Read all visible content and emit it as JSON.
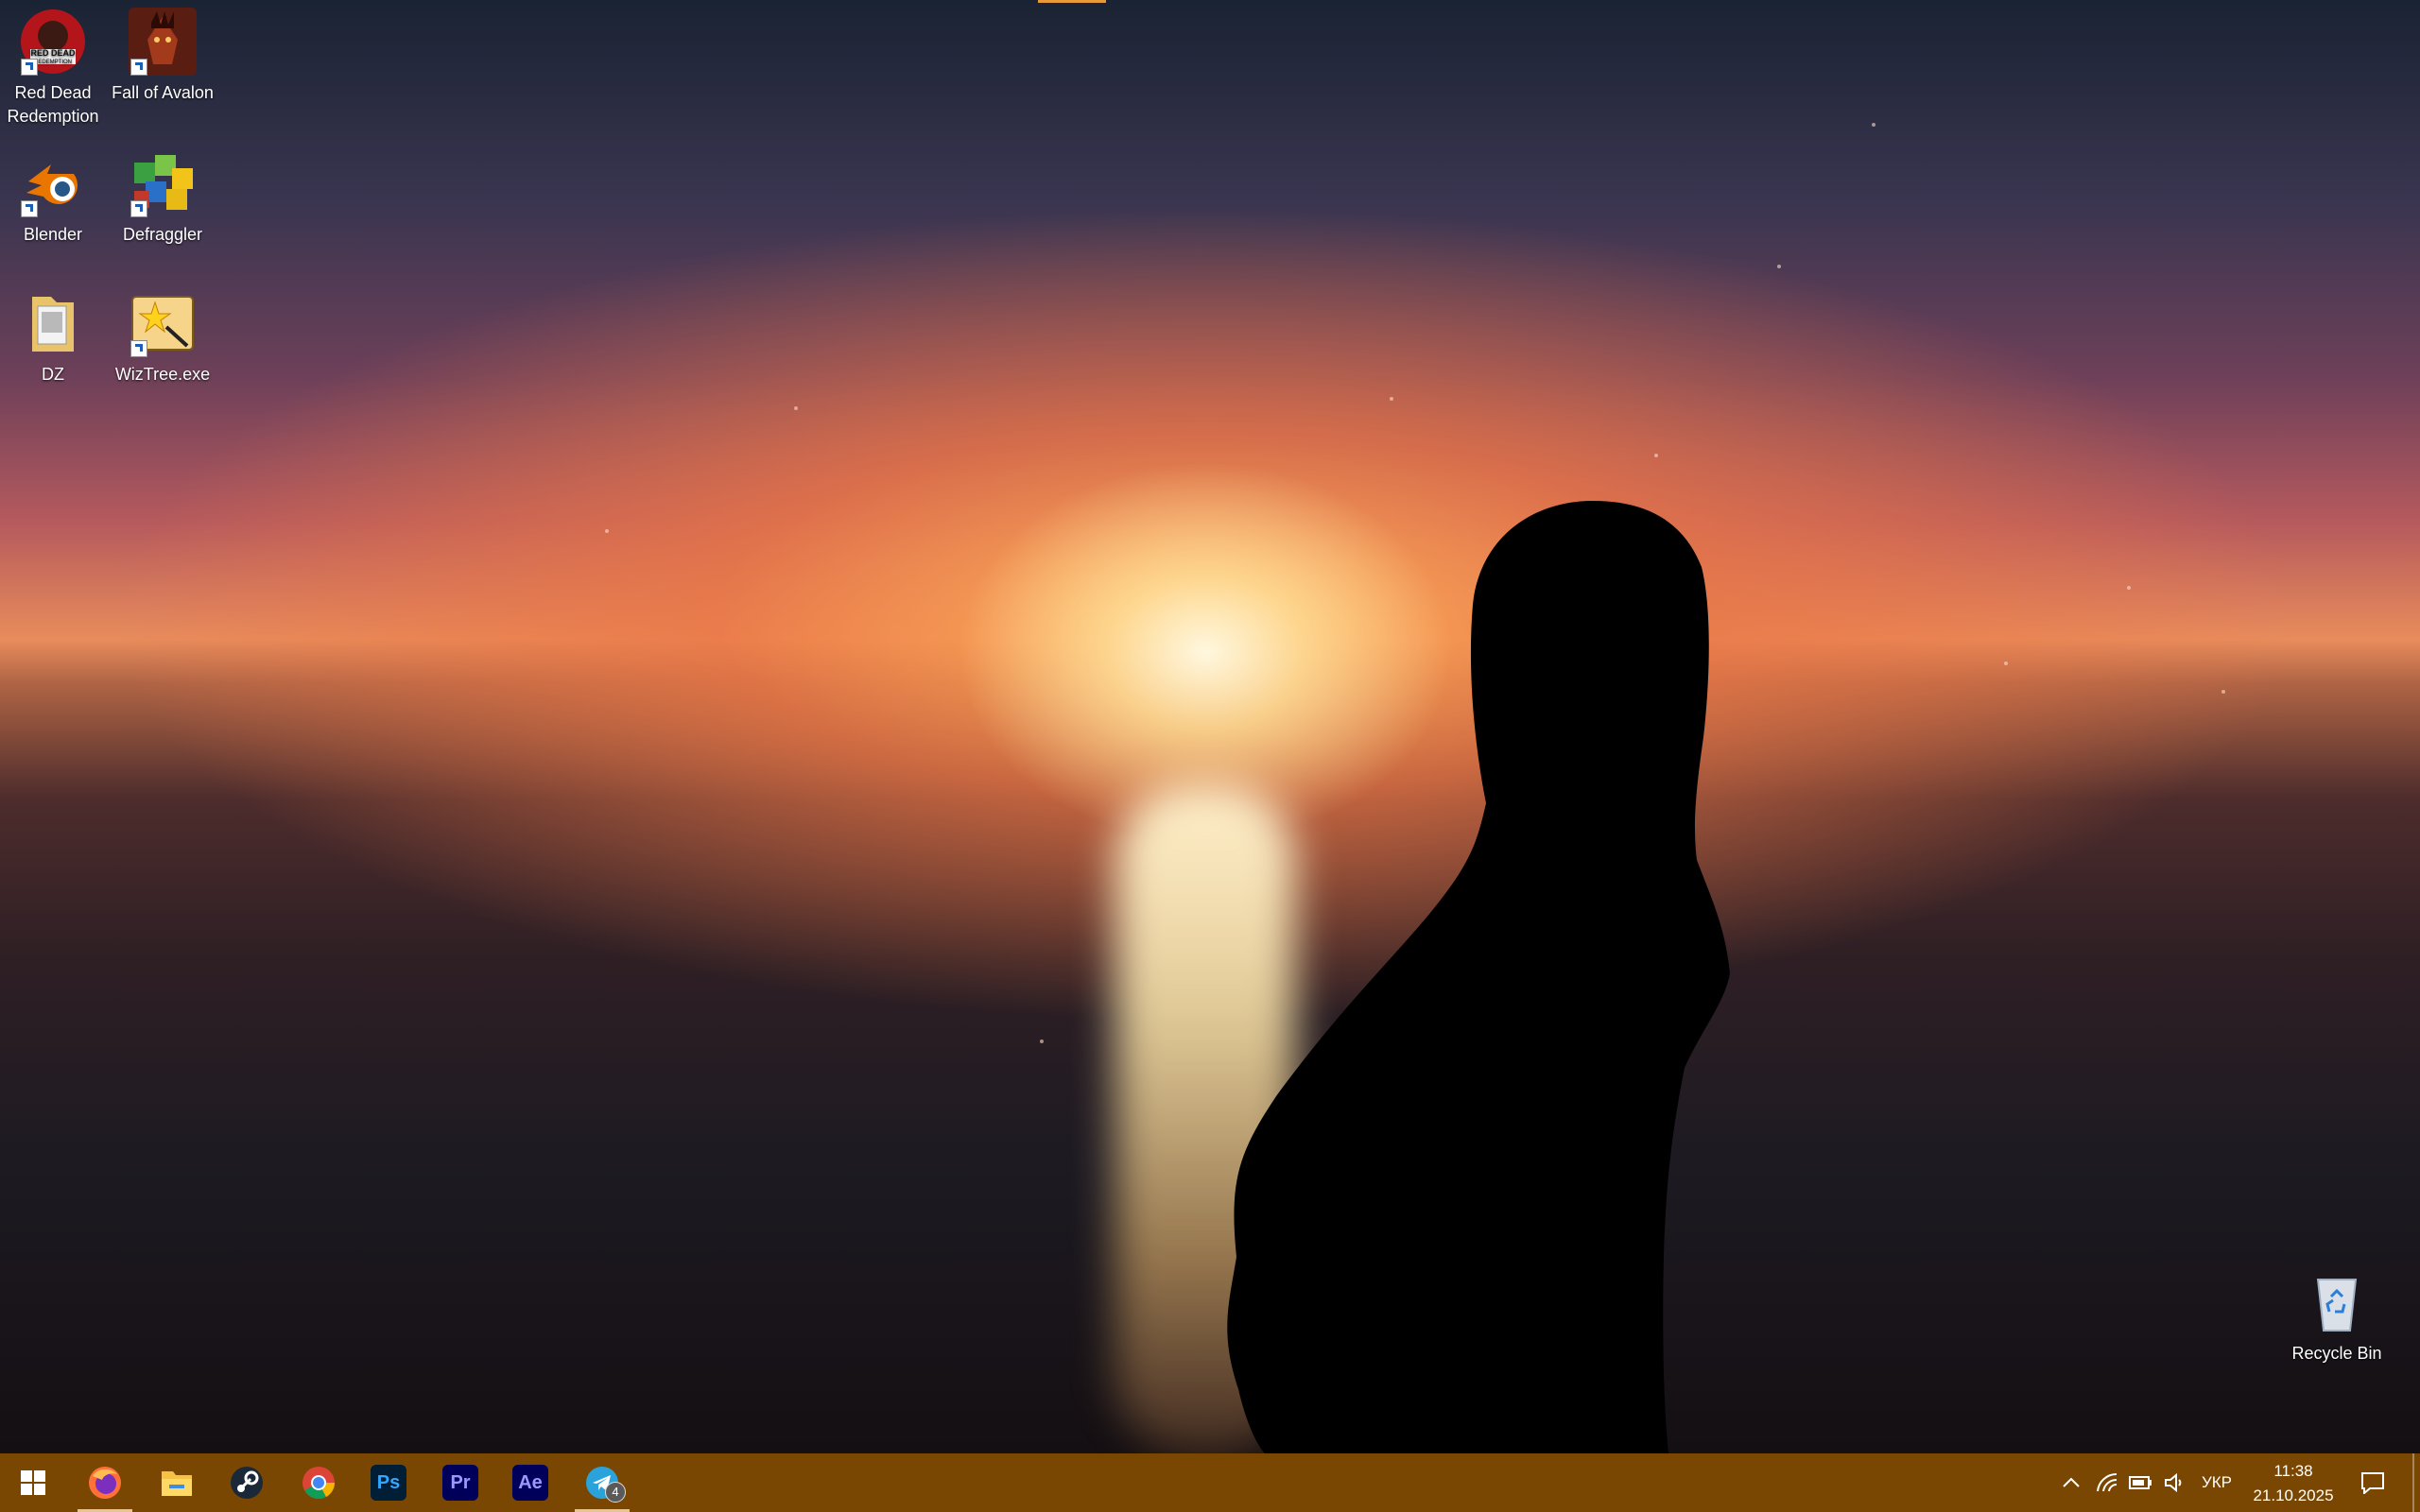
{
  "desktop": {
    "icons": [
      {
        "label": "Red Dead\nRedemption",
        "icon": "red-dead-redemption-icon"
      },
      {
        "label": "Fall of Avalon",
        "icon": "fall-of-avalon-icon"
      },
      {
        "label": "Blender",
        "icon": "blender-icon"
      },
      {
        "label": "Defraggler",
        "icon": "defraggler-icon"
      },
      {
        "label": "DZ",
        "icon": "folder-icon"
      },
      {
        "label": "WizTree.exe",
        "icon": "wiztree-icon"
      },
      {
        "label": "Recycle Bin",
        "icon": "recycle-bin-icon"
      }
    ],
    "logo_text": {
      "rdr_top": "RED DEAD",
      "rdr_bottom": "REDEMPTION"
    }
  },
  "taskbar": {
    "apps": [
      {
        "name": "Start",
        "icon": "windows-start-icon"
      },
      {
        "name": "Firefox",
        "icon": "firefox-icon",
        "active": true
      },
      {
        "name": "File Explorer",
        "icon": "file-explorer-icon"
      },
      {
        "name": "Steam",
        "icon": "steam-icon"
      },
      {
        "name": "Chrome",
        "icon": "chrome-icon"
      },
      {
        "name": "Photoshop",
        "icon": "photoshop-icon",
        "label": "Ps"
      },
      {
        "name": "Premiere Pro",
        "icon": "premiere-icon",
        "label": "Pr"
      },
      {
        "name": "After Effects",
        "icon": "after-effects-icon",
        "label": "Ae"
      },
      {
        "name": "Telegram",
        "icon": "telegram-icon",
        "active": true,
        "badge": "4"
      }
    ],
    "tray": {
      "language": "УКР",
      "time": "11:38",
      "date": "21.10.2025"
    },
    "color": "#7a4703"
  }
}
